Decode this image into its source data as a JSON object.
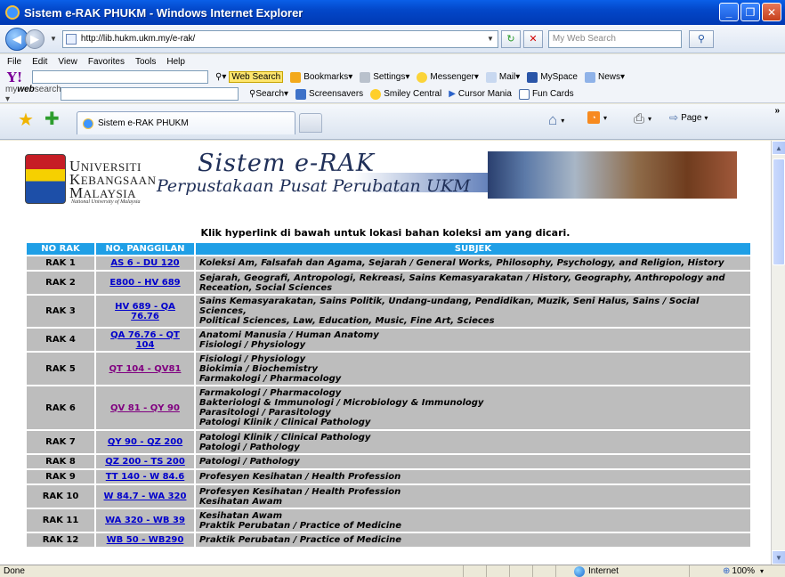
{
  "window": {
    "title": "Sistem e-RAK PHUKM - Windows Internet Explorer"
  },
  "address": {
    "url": "http://lib.hukm.ukm.my/e-rak/",
    "search_placeholder": "My Web Search"
  },
  "menu": [
    "File",
    "Edit",
    "View",
    "Favorites",
    "Tools",
    "Help"
  ],
  "toolbar1": {
    "web_search": "Web Search",
    "bookmarks": "Bookmarks",
    "settings": "Settings",
    "messenger": "Messenger",
    "mail": "Mail",
    "myspace": "MySpace",
    "news": "News"
  },
  "toolbar2": {
    "brand_my": "my",
    "brand_web": "web",
    "brand_search": "search",
    "search": "Search",
    "screensavers": "Screensavers",
    "smiley": "Smiley Central",
    "cursor": "Cursor Mania",
    "funcards": "Fun Cards"
  },
  "tab": {
    "label": "Sistem e-RAK PHUKM"
  },
  "commandbar": {
    "page": "Page"
  },
  "banner": {
    "univ_line1_cap": "U",
    "univ_line1": "NIVERSITI",
    "univ_line2_cap": "K",
    "univ_line2": "EBANGSAAN",
    "univ_line3_cap": "M",
    "univ_line3": "ALAYSIA",
    "univ_sub": "National University of Malaysia",
    "title": "Sistem e-RAK",
    "subtitle": "Perpustakaan Pusat Perubatan UKM"
  },
  "instruction": "Klik hyperlink di bawah untuk lokasi bahan koleksi am yang dicari.",
  "table": {
    "headers": [
      "NO RAK",
      "NO. PANGGILAN",
      "SUBJEK"
    ],
    "rows": [
      {
        "rak": "RAK 1",
        "call": "AS 6 - DU 120",
        "subject": [
          "Koleksi Am, Falsafah dan Agama, Sejarah / General Works, Philosophy, Psychology, and Religion, History"
        ]
      },
      {
        "rak": "RAK 2",
        "call": "E800 - HV 689",
        "subject": [
          "Sejarah, Geografi, Antropologi, Rekreasi, Sains Kemasyarakatan / History, Geography, Anthropology and",
          "Receation, Social Sciences"
        ]
      },
      {
        "rak": "RAK 3",
        "call": "HV 689 - QA 76.76",
        "subject": [
          "Sains Kemasyarakatan, Sains Politik, Undang-undang, Pendidikan, Muzik, Seni Halus, Sains / Social Sciences,",
          "Political Sciences, Law, Education, Music, Fine Art, Scieces"
        ]
      },
      {
        "rak": "RAK 4",
        "call": "QA 76.76 - QT 104",
        "subject": [
          "Anatomi Manusia / Human Anatomy",
          "Fisiologi / Physiology"
        ]
      },
      {
        "rak": "RAK 5",
        "call": "QT 104 - QV81",
        "subject": [
          "Fisiologi / Physiology",
          "Biokimia / Biochemistry",
          "Farmakologi / Pharmacology"
        ]
      },
      {
        "rak": "RAK 6",
        "call": "QV 81 - QY 90",
        "subject": [
          "Farmakologi / Pharmacology",
          "Bakteriologi & Immunologi / Microbiology & Immunology",
          "Parasitologi / Parasitology",
          "Patologi Klinik / Clinical Pathology"
        ]
      },
      {
        "rak": "RAK 7",
        "call": "QY 90 - QZ 200",
        "subject": [
          "Patologi Klinik / Clinical Pathology",
          "Patologi / Pathology"
        ]
      },
      {
        "rak": "RAK 8",
        "call": "QZ 200 - TS 200",
        "subject": [
          "Patologi / Pathology"
        ]
      },
      {
        "rak": "RAK 9",
        "call": "TT 140 - W 84.6",
        "subject": [
          "Profesyen Kesihatan / Health Profession"
        ]
      },
      {
        "rak": "RAK 10",
        "call": "W 84.7 - WA 320",
        "subject": [
          "Profesyen Kesihatan / Health Profession",
          "Kesihatan Awam"
        ]
      },
      {
        "rak": "RAK 11",
        "call": "WA 320 - WB 39",
        "subject": [
          "Kesihatan Awam",
          "Praktik Perubatan / Practice of Medicine"
        ]
      },
      {
        "rak": "RAK 12",
        "call": "WB 50 - WB290",
        "subject": [
          "Praktik Perubatan / Practice of Medicine"
        ]
      }
    ]
  },
  "status": {
    "left": "Done",
    "zone": "Internet",
    "zoom": "100%"
  }
}
